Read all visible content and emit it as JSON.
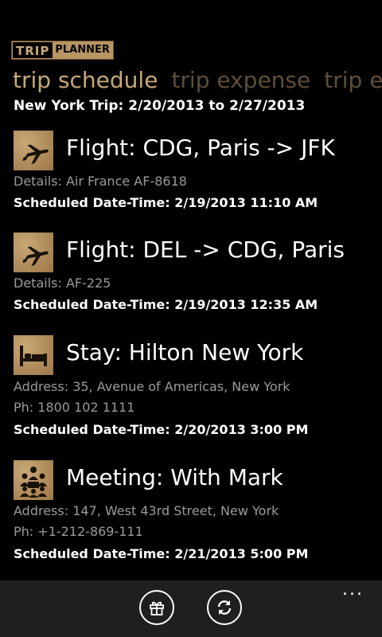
{
  "app": {
    "logo_part1": "TRIP",
    "logo_part2": "PLANNER"
  },
  "pivot": {
    "items": [
      {
        "label": "trip schedule",
        "active": true
      },
      {
        "label": "trip expense",
        "active": false
      },
      {
        "label": "trip ex",
        "active": false
      }
    ]
  },
  "trip": {
    "range": "New York Trip: 2/20/2013 to 2/27/2013"
  },
  "schedule": [
    {
      "icon": "airplane-icon",
      "title": "Flight: CDG, Paris -> JFK",
      "details": [
        "Details: Air France AF-8618"
      ],
      "scheduled": "Scheduled Date-Time: 2/19/2013 11:10 AM"
    },
    {
      "icon": "airplane-icon",
      "title": "Flight: DEL -> CDG, Paris",
      "details": [
        "Details: AF-225"
      ],
      "scheduled": "Scheduled Date-Time: 2/19/2013 12:35 AM"
    },
    {
      "icon": "bed-icon",
      "title": "Stay: Hilton New York",
      "details": [
        "Address: 35, Avenue of Americas, New York",
        "Ph: 1800 102 1111"
      ],
      "scheduled": "Scheduled Date-Time: 2/20/2013 3:00 PM"
    },
    {
      "icon": "meeting-icon",
      "title": "Meeting: With Mark",
      "details": [
        "Address: 147, West 43rd Street, New York",
        "Ph: +1-212-869-111"
      ],
      "scheduled": "Scheduled Date-Time: 2/21/2013 5:00 PM"
    }
  ],
  "appbar": {
    "buttons": [
      {
        "icon": "gift-icon"
      },
      {
        "icon": "refresh-icon"
      }
    ],
    "more": "..."
  },
  "colors": {
    "accent": "#c8a878",
    "inactive_pivot": "#5e4e3a",
    "tile": "#b8925c",
    "secondary_text": "#9a9a9a",
    "appbar_bg": "#1f1f1f"
  }
}
